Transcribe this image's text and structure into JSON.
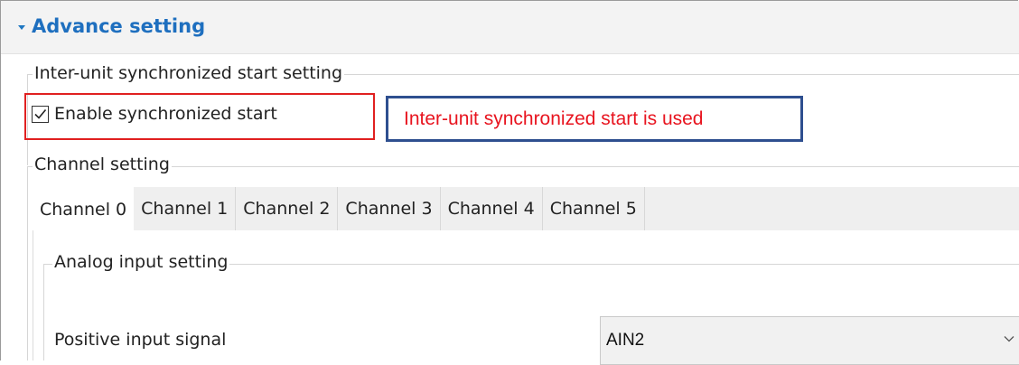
{
  "section": {
    "title": "Advance setting"
  },
  "sync_group": {
    "label": "Inter-unit synchronized start setting",
    "checkbox_label": "Enable synchronized start",
    "checked": true,
    "annotation": "Inter-unit synchronized start is used"
  },
  "channel_group": {
    "label": "Channel setting",
    "tabs": [
      {
        "label": "Channel 0",
        "active": true
      },
      {
        "label": "Channel 1",
        "active": false
      },
      {
        "label": "Channel 2",
        "active": false
      },
      {
        "label": "Channel 3",
        "active": false
      },
      {
        "label": "Channel 4",
        "active": false
      },
      {
        "label": "Channel 5",
        "active": false
      }
    ]
  },
  "analog_group": {
    "label": "Analog input setting",
    "positive_input": {
      "label": "Positive input signal",
      "value": "AIN2"
    }
  },
  "colors": {
    "header_text": "#1e6fbf",
    "highlight_red": "#e02020",
    "highlight_blue": "#2e4f8f",
    "annotation_text": "#e8141f"
  },
  "icons": {
    "expand": "triangle-down-icon",
    "check": "checkmark-icon",
    "dropdown": "chevron-down-icon"
  }
}
